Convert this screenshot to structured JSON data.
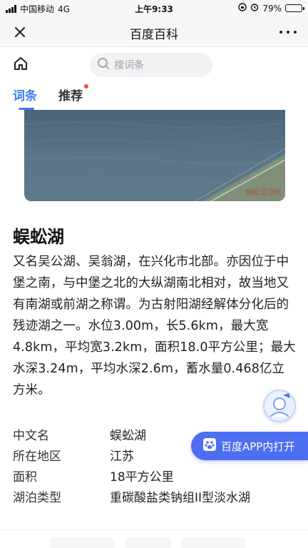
{
  "status_bar": {
    "carrier": "中国移动",
    "network": "4G",
    "time": "上午9:33",
    "battery_text": "79%",
    "battery_level": 0.79
  },
  "nav_bar": {
    "title": "百度百科"
  },
  "header": {
    "search_placeholder": "搜词条",
    "tabs": [
      {
        "label": "词条",
        "active": true
      },
      {
        "label": "推荐",
        "active": false,
        "has_dot": true
      }
    ],
    "accent_color": "#3b7ef0"
  },
  "image": {
    "watermark": "蜈蚣湖湿地"
  },
  "entry": {
    "title": "蜈蚣湖",
    "summary": "又名吴公湖、吴翁湖，在兴化市北部。亦因位于中堡之南，与中堡之北的大纵湖南北相对，故当地又有南湖或前湖之称谓。为古射阳湖经解体分化后的残迹湖之一。水位3.00m，长5.6km，最大宽4.8km，平均宽3.2km，面积18.0平方公里；最大水深3.24m，平均水深2.6m，蓄水量0.468亿立方米。"
  },
  "info_table": [
    {
      "key": "中文名",
      "value": "蜈蚣湖"
    },
    {
      "key": "所在地区",
      "value": "江苏"
    },
    {
      "key": "面积",
      "value": "18平方公里"
    },
    {
      "key": "湖泊类型",
      "value": "重碳酸盐类钠组II型淡水湖"
    }
  ],
  "app_button": {
    "label": "百度APP内打开",
    "color": "#4e6ef2"
  }
}
